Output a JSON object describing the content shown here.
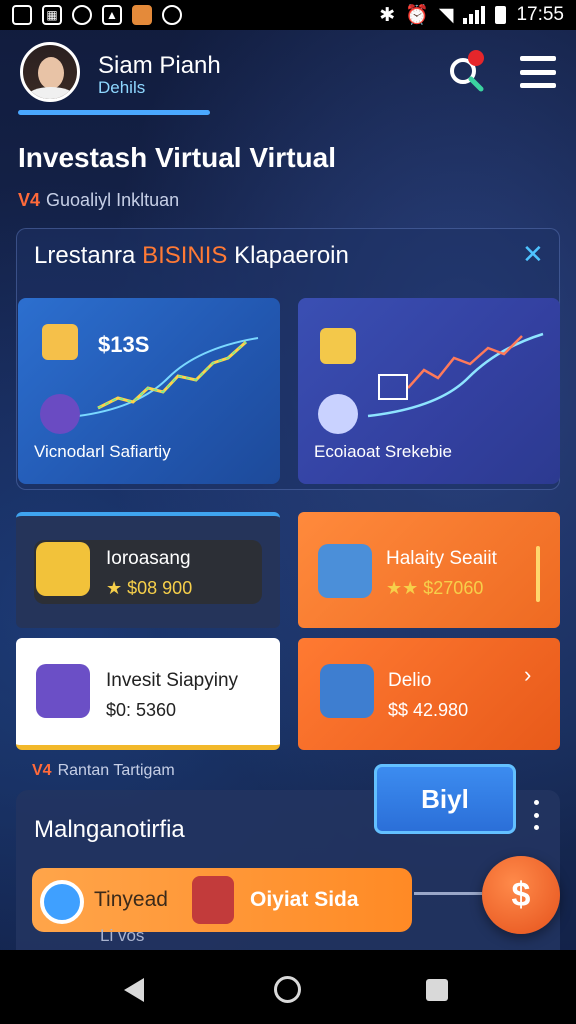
{
  "status_bar": {
    "time": "17:55"
  },
  "header": {
    "user_name": "Siam Pianh",
    "user_sub": "Dehils"
  },
  "page": {
    "title": "Investash Virtual Virtual",
    "subtitle_tag": "V4",
    "subtitle": "Guoaliyl Inkltuan"
  },
  "panel": {
    "title_pre": "Lrestanra",
    "title_highlight": "BISINIS",
    "title_post": "Klapaeroin",
    "close": "✕",
    "cards": [
      {
        "value": "$13S",
        "label": "Vicnodarl Safiartiy"
      },
      {
        "value": "",
        "label": "Ecoiaoat Srekebie"
      }
    ]
  },
  "tiles": [
    {
      "name": "Ioroasang",
      "amount": "★ $08 900"
    },
    {
      "name": "Halaity Seaiit",
      "amount": "★★ $27060"
    },
    {
      "name": "Invesit Siapyiny",
      "amount": "$0: 5360"
    },
    {
      "name": "Delio",
      "amount": "$$ 42.980"
    }
  ],
  "section2": {
    "tag": "V4",
    "label": "Rantan Tartigam"
  },
  "bottom": {
    "title": "Malnganotirfia",
    "buy_label": "Biyl",
    "action_left": "Tinyead",
    "action_right": "Oiyiat Sida",
    "fab": "$",
    "cut_text": "Li vos"
  },
  "colors": {
    "accent_blue": "#4aa8ff",
    "accent_orange": "#ff7a35",
    "card_blue": "#2c6fcf",
    "tile_orange": "#ff8a3c"
  }
}
